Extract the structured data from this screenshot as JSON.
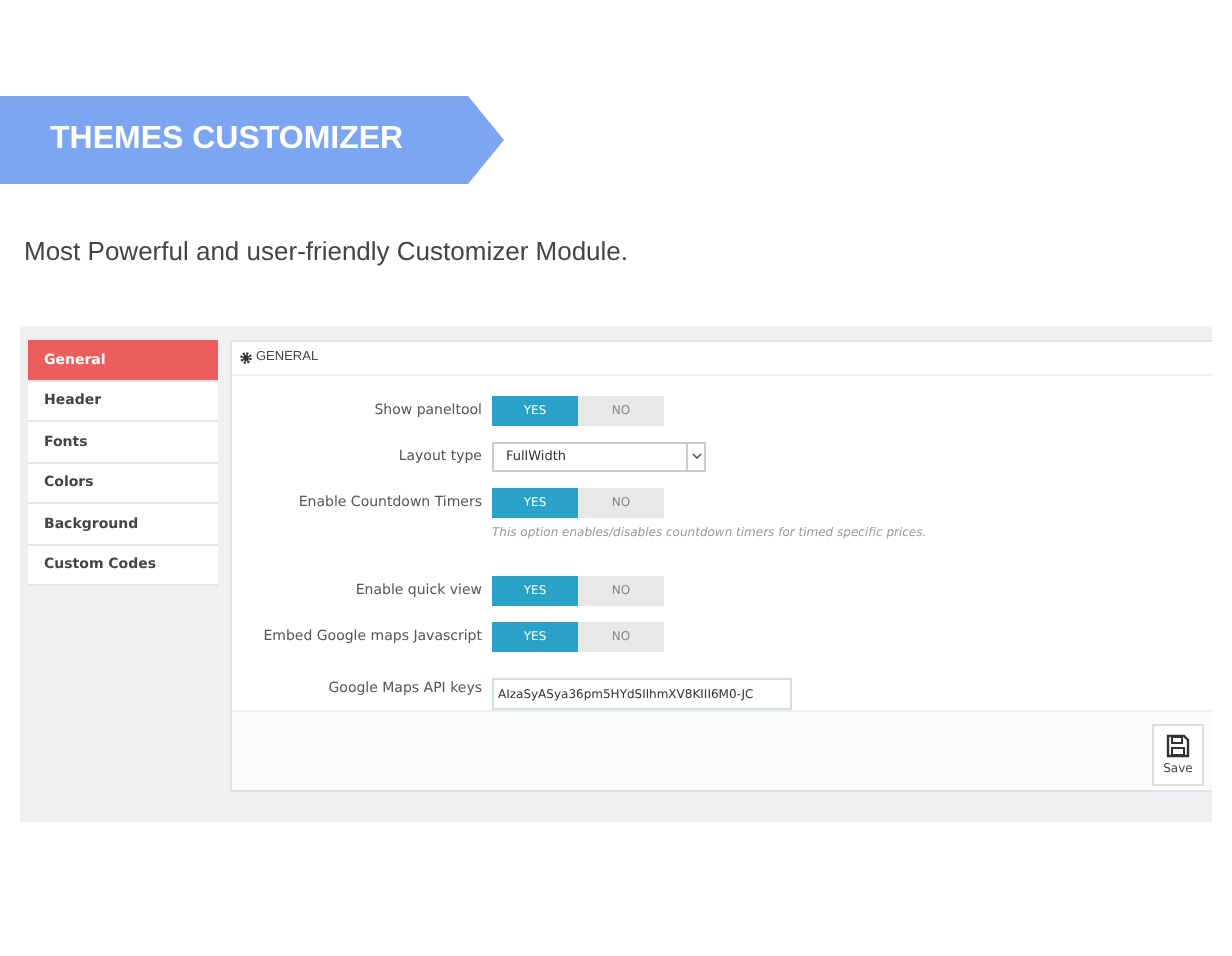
{
  "banner": {
    "title": "THEMES CUSTOMIZER"
  },
  "subtitle": "Most Powerful and user-friendly Customizer Module.",
  "sidebar": {
    "items": [
      {
        "label": "General",
        "selected": true
      },
      {
        "label": "Header",
        "selected": false
      },
      {
        "label": "Fonts",
        "selected": false
      },
      {
        "label": "Colors",
        "selected": false
      },
      {
        "label": "Background",
        "selected": false
      },
      {
        "label": "Custom Codes",
        "selected": false
      }
    ]
  },
  "panel": {
    "title": "GENERAL",
    "fields": [
      {
        "kind": "toggle",
        "label": "Show paneltool",
        "options": [
          {
            "label": "YES",
            "selected": true
          },
          {
            "label": "NO",
            "selected": false
          }
        ]
      },
      {
        "kind": "select",
        "label": "Layout type",
        "value": "FullWidth"
      },
      {
        "kind": "toggle",
        "label": "Enable Countdown Timers",
        "options": [
          {
            "label": "YES",
            "selected": true
          },
          {
            "label": "NO",
            "selected": false
          }
        ],
        "hint": "This option enables/disables countdown timers for timed specific prices."
      },
      {
        "kind": "toggle",
        "label": "Enable quick view",
        "options": [
          {
            "label": "YES",
            "selected": true
          },
          {
            "label": "NO",
            "selected": false
          }
        ]
      },
      {
        "kind": "toggle",
        "label": "Embed Google maps Javascript",
        "options": [
          {
            "label": "YES",
            "selected": true
          },
          {
            "label": "NO",
            "selected": false
          }
        ]
      },
      {
        "kind": "text",
        "label": "Google Maps API keys",
        "value": "AIzaSyASya36pm5HYdSIlhmXV8KIII6M0-JC"
      }
    ],
    "save": "Save"
  }
}
